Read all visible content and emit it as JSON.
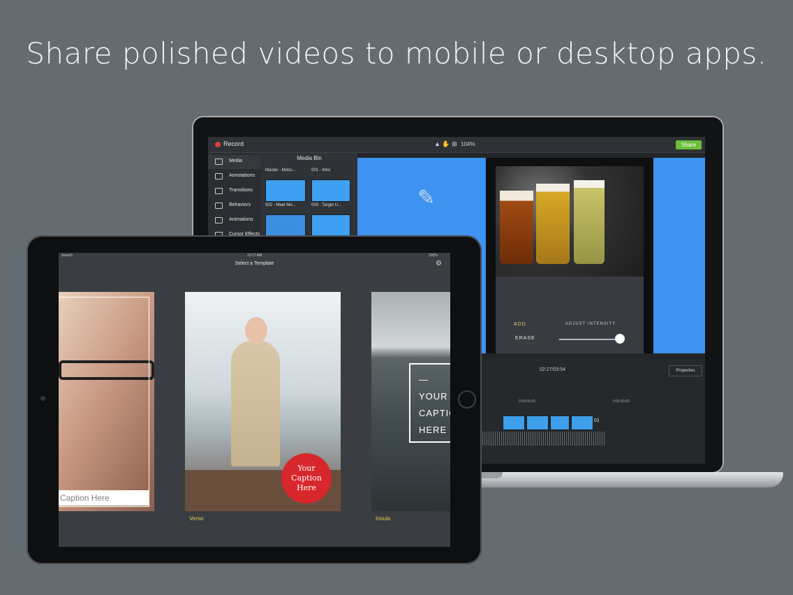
{
  "headline": "Share polished videos to mobile or desktop apps.",
  "laptop": {
    "app": {
      "record_label": "Record",
      "zoom_label": "104%",
      "share_label": "Share",
      "sidebar": [
        "Media",
        "Annotations",
        "Transitions",
        "Behaviors",
        "Animations",
        "Cursor Effects"
      ],
      "media_bin": {
        "title": "Media Bin",
        "items": [
          "Master - Motio...",
          "001 - Intro",
          "002 - Meet Mo...",
          "003 - Target U..."
        ]
      },
      "tools": {
        "add": "ADD",
        "erase": "ERASE",
        "adjust": "ADJUST INTENSITY"
      },
      "timeline": {
        "time": "02:27/03:54",
        "properties": "Properties",
        "marks": [
          "0:00:00;00",
          "0:00:30;00"
        ],
        "clip_label": "01"
      }
    }
  },
  "tablet": {
    "status": {
      "carrier": "Search",
      "time": "10:17 AM",
      "battery": "100%"
    },
    "nav_title": "Select a Template",
    "templates": [
      {
        "name": "",
        "caption": "Caption Here"
      },
      {
        "name": "Verso",
        "caption_lines": [
          "Your",
          "Caption",
          "Here"
        ]
      },
      {
        "name": "Insula",
        "caption_lines": [
          "—",
          "YOUR",
          "CAPTIO",
          "HERE"
        ]
      }
    ]
  },
  "colors": {
    "background": "#646c72",
    "accent_yellow": "#e8c756",
    "share_green": "#6bbf3a",
    "badge_red": "#d7272c"
  }
}
